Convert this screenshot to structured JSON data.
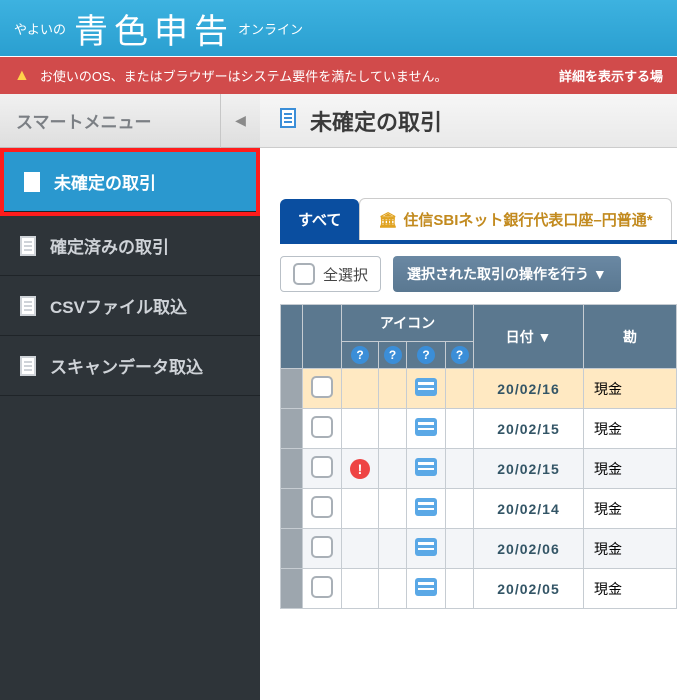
{
  "header": {
    "prefix": "やよいの",
    "main": "青色申告",
    "suffix": "オンライン"
  },
  "alert": {
    "text": "お使いのOS、またはブラウザーはシステム要件を満たしていません。",
    "detail": "詳細を表示する場"
  },
  "smartmenu": {
    "label": "スマートメニュー"
  },
  "nav": {
    "items": [
      {
        "label": "未確定の取引",
        "active": true
      },
      {
        "label": "確定済みの取引"
      },
      {
        "label": "CSVファイル取込"
      },
      {
        "label": "スキャンデータ取込"
      }
    ]
  },
  "page": {
    "title": "未確定の取引"
  },
  "tabs": {
    "all": "すべて",
    "bank": "住信SBIネット銀行代表口座–円普通*"
  },
  "toolbar": {
    "select_all": "全選択",
    "operate": "選択された取引の操作を行う ▼"
  },
  "table": {
    "headers": {
      "icon": "アイコン",
      "date": "日付 ▼",
      "account": "勘"
    },
    "rows": [
      {
        "date": "20/02/16",
        "account": "現金",
        "warn": false
      },
      {
        "date": "20/02/15",
        "account": "現金",
        "warn": false
      },
      {
        "date": "20/02/15",
        "account": "現金",
        "warn": true
      },
      {
        "date": "20/02/14",
        "account": "現金",
        "warn": false
      },
      {
        "date": "20/02/06",
        "account": "現金",
        "warn": false
      },
      {
        "date": "20/02/05",
        "account": "現金",
        "warn": false
      }
    ]
  }
}
